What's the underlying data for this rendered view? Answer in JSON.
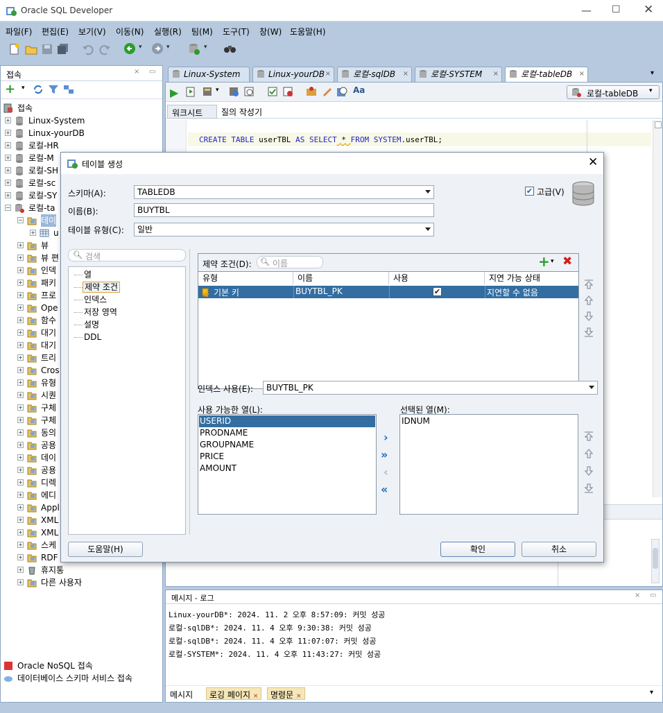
{
  "app": {
    "title": "Oracle SQL Developer",
    "menu": [
      "파일(F)",
      "편집(E)",
      "보기(V)",
      "이동(N)",
      "실행(R)",
      "팀(M)",
      "도구(T)",
      "창(W)",
      "도움말(H)"
    ]
  },
  "left_panel": {
    "title": "접속",
    "root": "접속",
    "items": [
      {
        "label": "Linux-System"
      },
      {
        "label": "Linux-yourDB"
      },
      {
        "label": "로컬-HR"
      },
      {
        "label": "로컬-M"
      },
      {
        "label": "로컬-SH"
      },
      {
        "label": "로컬-sc"
      },
      {
        "label": "로컬-SY"
      },
      {
        "label": "로컬-ta"
      },
      {
        "label": "테이"
      },
      {
        "label": "u"
      },
      {
        "label": "뷰"
      },
      {
        "label": "뷰 편"
      },
      {
        "label": "인덱"
      },
      {
        "label": "패키"
      },
      {
        "label": "프로"
      },
      {
        "label": "Ope"
      },
      {
        "label": "함수"
      },
      {
        "label": "대기"
      },
      {
        "label": "대기"
      },
      {
        "label": "트리"
      },
      {
        "label": "Cros"
      },
      {
        "label": "유형"
      },
      {
        "label": "시퀀"
      },
      {
        "label": "구체"
      },
      {
        "label": "구체"
      },
      {
        "label": "동의"
      },
      {
        "label": "공용"
      },
      {
        "label": "데이"
      },
      {
        "label": "공용"
      },
      {
        "label": "디렉"
      },
      {
        "label": "에디"
      },
      {
        "label": "Appl"
      },
      {
        "label": "XML"
      },
      {
        "label": "XML"
      },
      {
        "label": "스케"
      },
      {
        "label": "RDF"
      },
      {
        "label": "휴지통"
      },
      {
        "label": "다른 사용자"
      }
    ],
    "nosql": "Oracle NoSQL 접속",
    "schema_service": "데이터베이스 스키마 서비스 접속"
  },
  "tabs": [
    {
      "label": "Linux-System",
      "active": false
    },
    {
      "label": "Linux-yourDB",
      "active": false
    },
    {
      "label": "로컬-sqlDB",
      "active": false
    },
    {
      "label": "로컬-SYSTEM",
      "active": false
    },
    {
      "label": "로컬-tableDB",
      "active": true
    }
  ],
  "editor": {
    "connection": "로컬-tableDB",
    "subtabs": [
      "워크시트",
      "질의 작성기"
    ],
    "sql": {
      "kw1": "CREATE TABLE",
      "t1": " userTBL ",
      "kw2": "AS SELECT",
      "star": " * ",
      "kw3": "FROM",
      "t2": " SYSTEM",
      "t3": ".userTBL;"
    }
  },
  "log": {
    "title": "메시지 - 로그",
    "lines": [
      "Linux-yourDB*: 2024. 11. 2 오후 8:57:09: 커밋 성공",
      "로컬-sqlDB*: 2024. 11. 4 오후 9:30:38: 커밋 성공",
      "로컬-sqlDB*: 2024. 11. 4 오후 11:07:07: 커밋 성공",
      "로컬-SYSTEM*: 2024. 11. 4 오후 11:43:27: 커밋 성공"
    ],
    "tabs": [
      "메시지",
      "로깅 페이지",
      "명령문"
    ]
  },
  "dialog": {
    "title": "테이블 생성",
    "schema_label": "스키마(A):",
    "schema_value": "TABLEDB",
    "name_label": "이름(B):",
    "name_value": "BUYTBL",
    "type_label": "테이블 유형(C):",
    "type_value": "일반",
    "advanced_label": "고급(V)",
    "search_placeholder": "검색",
    "nav": [
      "열",
      "제약 조건",
      "인덱스",
      "저장 영역",
      "설명",
      "DDL"
    ],
    "constraints_label": "제약 조건(D):",
    "constraints_search": "이름",
    "columns": [
      "유형",
      "이름",
      "사용",
      "지연 가능 상태"
    ],
    "rows": [
      {
        "type": "기본 키",
        "name": "BUYTBL_PK",
        "use": "☑",
        "deferrable": "지연할 수 없음"
      }
    ],
    "index_label": "인덱스 사용(E):",
    "index_value": "BUYTBL_PK",
    "available_label": "사용 가능한 열(L):",
    "available": [
      "USERID",
      "PRODNAME",
      "GROUPNAME",
      "PRICE",
      "AMOUNT"
    ],
    "selected_label": "선택된 열(M):",
    "selected": [
      "IDNUM"
    ],
    "help_btn": "도움말(H)",
    "ok_btn": "확인",
    "cancel_btn": "취소"
  }
}
